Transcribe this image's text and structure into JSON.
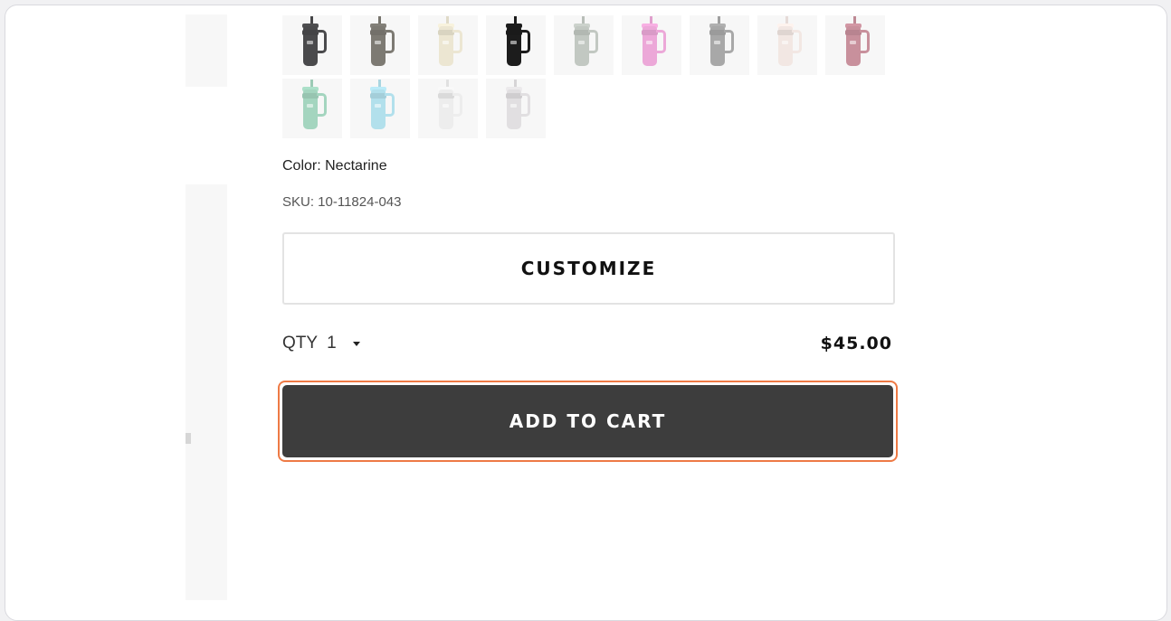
{
  "product": {
    "swatches": [
      {
        "name": "charcoal",
        "color": "#4a4a4c"
      },
      {
        "name": "stone-gray",
        "color": "#7d7a73"
      },
      {
        "name": "cream",
        "color": "#ece6d2"
      },
      {
        "name": "black",
        "color": "#1c1c1c"
      },
      {
        "name": "sage-gray",
        "color": "#c2c8c2"
      },
      {
        "name": "pink",
        "color": "#eca8d8"
      },
      {
        "name": "ash",
        "color": "#a8a8a8"
      },
      {
        "name": "blush",
        "color": "#f2e7e3"
      },
      {
        "name": "rose",
        "color": "#c8909c"
      },
      {
        "name": "mint",
        "color": "#a4d5bf"
      },
      {
        "name": "sky",
        "color": "#b2e0ec"
      },
      {
        "name": "white",
        "color": "#ededed"
      },
      {
        "name": "light-gray",
        "color": "#e1dfe1"
      }
    ],
    "color_label": "Color: Nectarine",
    "sku_label": "SKU: 10-11824-043",
    "customize_label": "CUSTOMIZE",
    "qty_label": "QTY",
    "qty_value": "1",
    "price": "$45.00",
    "add_to_cart_label": "ADD TO CART"
  },
  "colors": {
    "add_button_bg": "#3d3d3d",
    "focus_ring": "#ee7a45"
  }
}
